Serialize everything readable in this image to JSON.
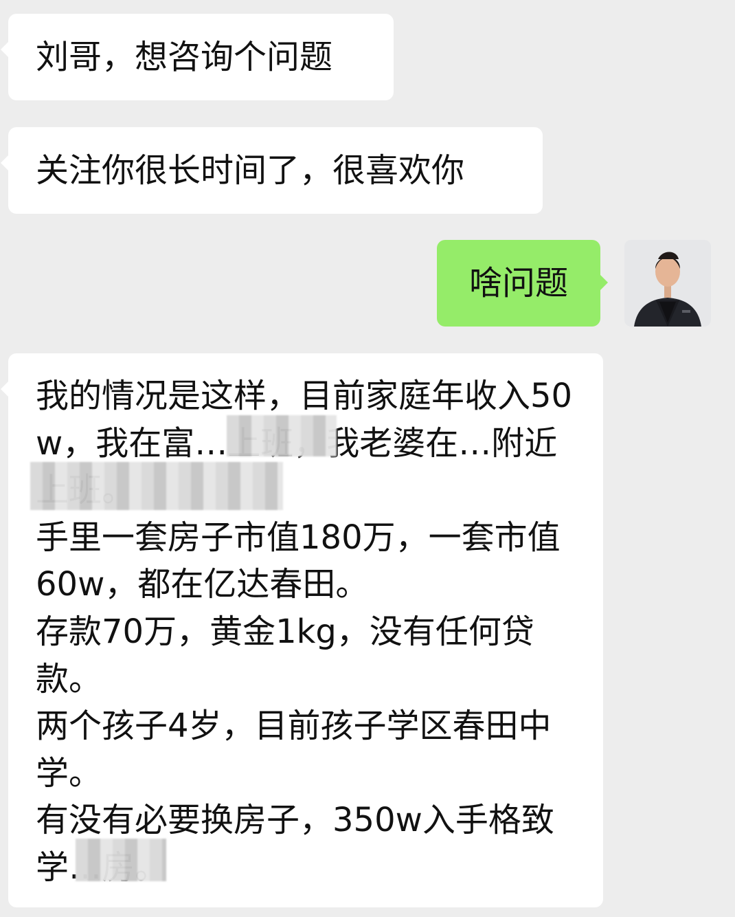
{
  "conversation": {
    "messages": [
      {
        "direction": "incoming",
        "text": "刘哥，想咨询个问题"
      },
      {
        "direction": "incoming",
        "text": "关注你很长时间了，很喜欢你"
      },
      {
        "direction": "outgoing",
        "text": "啥问题"
      },
      {
        "direction": "incoming",
        "text": "我的情况是这样，目前家庭年收入50w，我在富…上班，我老婆在…附近上班。\n手里一套房子市值180万，一套市值60w，都在亿达春田。\n存款70万，黄金1kg，没有任何贷款。\n两个孩子4岁，目前孩子学区春田中学。\n有没有必要换房子，350w入手格致学…房。"
      }
    ],
    "self_avatar": {
      "icon": "person-avatar-icon"
    },
    "redactions": [
      {
        "icon": "redaction-blur"
      },
      {
        "icon": "redaction-blur"
      },
      {
        "icon": "redaction-blur"
      }
    ]
  },
  "colors": {
    "background": "#ededed",
    "incoming_bubble": "#ffffff",
    "outgoing_bubble": "#95ec69",
    "text": "#111111"
  }
}
